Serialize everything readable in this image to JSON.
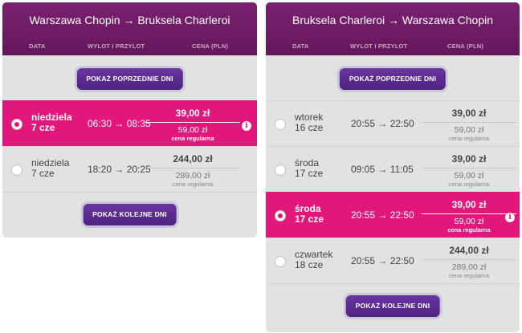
{
  "colors": {
    "header": "#6e1b64",
    "selected": "#e2177b",
    "button": "#5c2a8c",
    "panel": "#e2e2e2"
  },
  "columns": {
    "date": "DATA",
    "times": "WYLOT I PRZYLOT",
    "price": "CENA (PLN)"
  },
  "outbound": {
    "route": "Warszawa Chopin → Bruksela Charleroi",
    "prev_button": "POKAŻ POPRZEDNIE DNI",
    "next_button": "POKAŻ KOLEJNE DNI",
    "flights": [
      {
        "day": "niedziela",
        "date": "7 cze",
        "times": "06:30 → 08:35",
        "price": "39,00 zł",
        "regular_price": "59,00 zł",
        "regular_label": "cena regularna",
        "selected": true
      },
      {
        "day": "niedziela",
        "date": "7 cze",
        "times": "18:20 → 20:25",
        "price": "244,00 zł",
        "regular_price": "289,00 zł",
        "regular_label": "cena regularna",
        "selected": false
      }
    ]
  },
  "return": {
    "route": "Bruksela Charleroi → Warszawa Chopin",
    "prev_button": "POKAŻ POPRZEDNIE DNI",
    "next_button": "POKAŻ KOLEJNE DNI",
    "flights": [
      {
        "day": "wtorek",
        "date": "16 cze",
        "times": "20:55 → 22:50",
        "price": "39,00 zł",
        "regular_price": "59,00 zł",
        "regular_label": "cena regularna",
        "selected": false
      },
      {
        "day": "środa",
        "date": "17 cze",
        "times": "09:05 → 11:05",
        "price": "39,00 zł",
        "regular_price": "59,00 zł",
        "regular_label": "cena regularna",
        "selected": false
      },
      {
        "day": "środa",
        "date": "17 cze",
        "times": "20:55 → 22:50",
        "price": "39,00 zł",
        "regular_price": "59,00 zł",
        "regular_label": "cena regularna",
        "selected": true
      },
      {
        "day": "czwartek",
        "date": "18 cze",
        "times": "20:55 → 22:50",
        "price": "244,00 zł",
        "regular_price": "289,00 zł",
        "regular_label": "cena regularna",
        "selected": false
      }
    ]
  }
}
